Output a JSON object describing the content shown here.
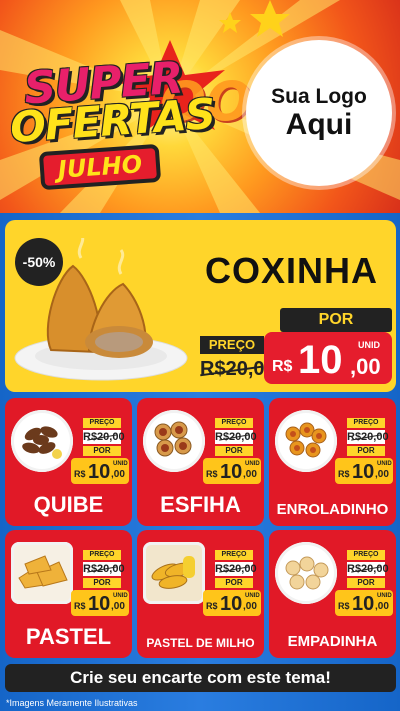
{
  "header": {
    "title_line1": "SUPER",
    "title_line2": "OFERTAS",
    "title_month": "JULHO",
    "boom_text": "OOO",
    "logo_line1": "Sua Logo",
    "logo_line2": "Aqui"
  },
  "colors": {
    "blue_bg": "#1a4fb0",
    "featured_yellow": "#ffd52a",
    "card_red": "#e11927",
    "price_red": "#e51d2d",
    "dark": "#222222",
    "white": "#ffffff"
  },
  "featured": {
    "discount": "-50%",
    "name": "COXINHA",
    "preco_label": "PREÇO",
    "old_price": "R$20,00",
    "por_label": "POR",
    "currency": "R$",
    "price_int": "10",
    "price_dec": ",00",
    "unit": "UNID",
    "icon": "coxinha-image"
  },
  "products": [
    {
      "name": "QUIBE",
      "preco_label": "PREÇO",
      "old_price": "R$20,00",
      "por_label": "POR",
      "currency": "R$",
      "price_int": "10",
      "price_dec": ",00",
      "unit": "UNID",
      "icon": "quibe-image"
    },
    {
      "name": "ESFIHA",
      "preco_label": "PREÇO",
      "old_price": "R$20,00",
      "por_label": "POR",
      "currency": "R$",
      "price_int": "10",
      "price_dec": ",00",
      "unit": "UNID",
      "icon": "esfiha-image"
    },
    {
      "name": "ENROLADINHO",
      "preco_label": "PREÇO",
      "old_price": "R$20,00",
      "por_label": "POR",
      "currency": "R$",
      "price_int": "10",
      "price_dec": ",00",
      "unit": "UNID",
      "icon": "enroladinho-image"
    },
    {
      "name": "PASTEL",
      "preco_label": "PREÇO",
      "old_price": "R$20,00",
      "por_label": "POR",
      "currency": "R$",
      "price_int": "10",
      "price_dec": ",00",
      "unit": "UNID",
      "icon": "pastel-image"
    },
    {
      "name": "PASTEL DE MILHO",
      "preco_label": "PREÇO",
      "old_price": "R$20,00",
      "por_label": "POR",
      "currency": "R$",
      "price_int": "10",
      "price_dec": ",00",
      "unit": "UNID",
      "icon": "pastel-de-milho-image"
    },
    {
      "name": "EMPADINHA",
      "preco_label": "PREÇO",
      "old_price": "R$20,00",
      "por_label": "POR",
      "currency": "R$",
      "price_int": "10",
      "price_dec": ",00",
      "unit": "UNID",
      "icon": "empadinha-image"
    }
  ],
  "footer": {
    "cta": "Crie seu encarte com este tema!",
    "disclaimer": "*Imagens Meramente Ilustrativas"
  }
}
